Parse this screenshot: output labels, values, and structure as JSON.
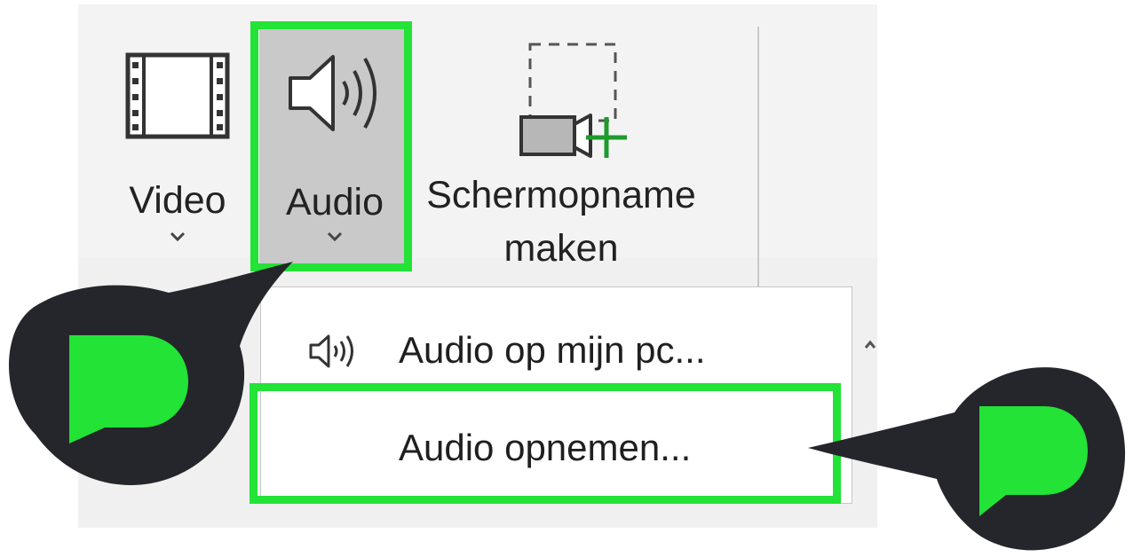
{
  "ribbon": {
    "buttons": [
      {
        "label": "Video"
      },
      {
        "label": "Audio"
      },
      {
        "label_line1": "Schermopname",
        "label_line2": "maken"
      }
    ]
  },
  "menu": {
    "items": [
      {
        "label": "Audio op mijn pc..."
      },
      {
        "label": "Audio opnemen..."
      }
    ]
  },
  "colors": {
    "highlight": "#22e336",
    "bubble": "#25262b",
    "selected_button": "#c9c9c9"
  }
}
